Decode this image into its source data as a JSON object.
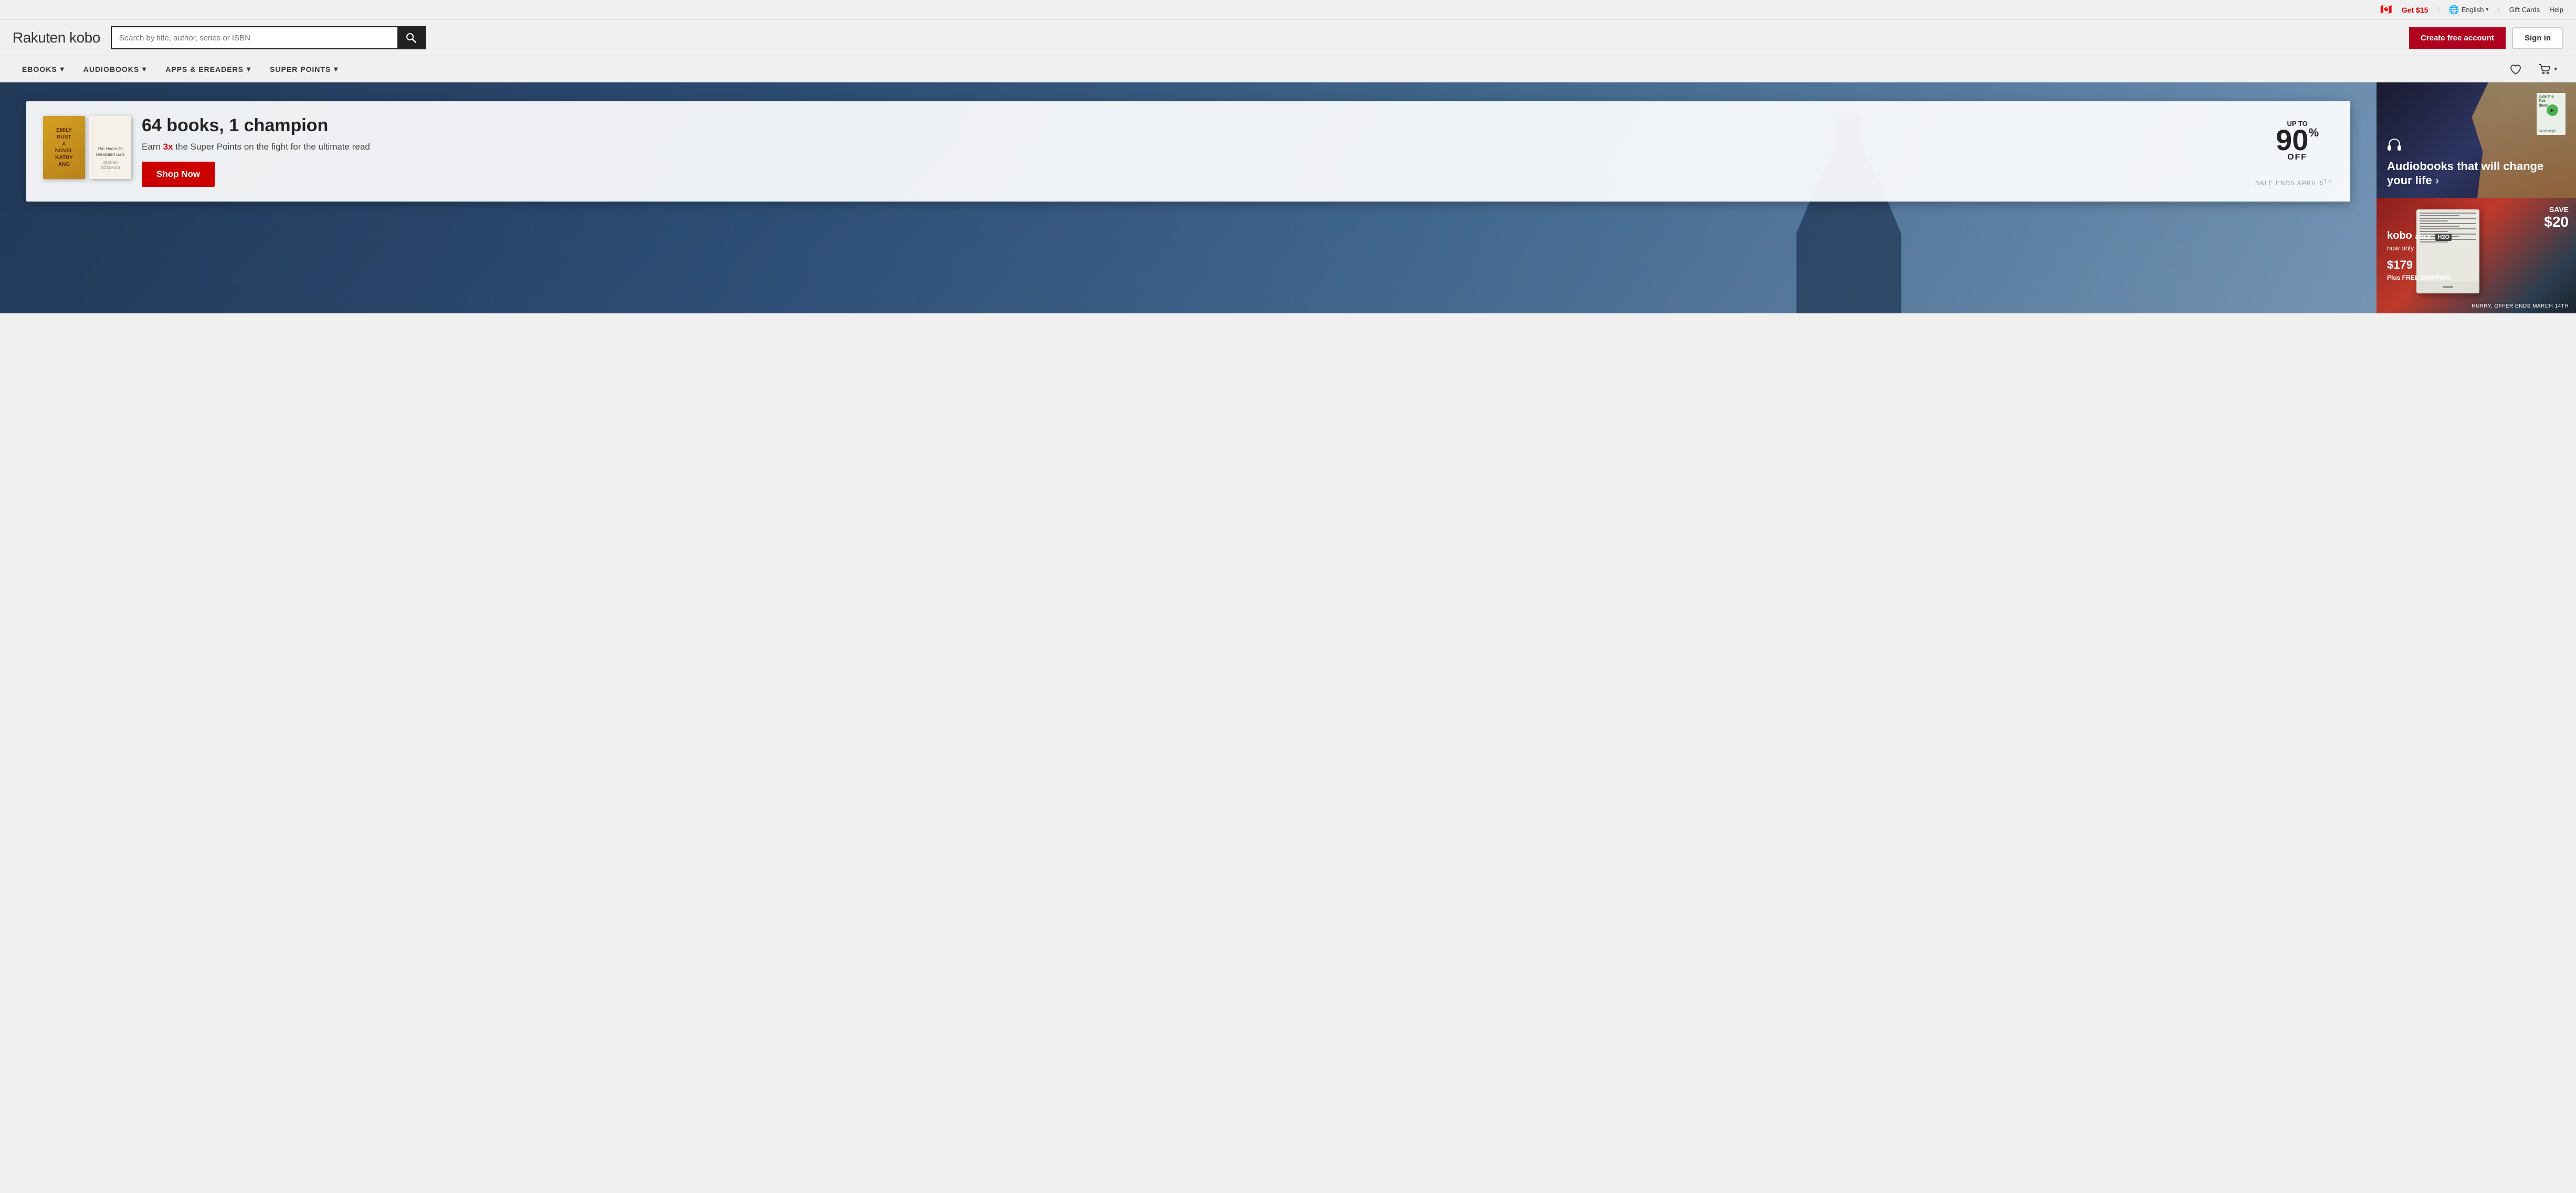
{
  "topbar": {
    "flag": "🇨🇦",
    "offer_label": "Get $15",
    "lang_label": "English",
    "gift_cards_label": "Gift Cards",
    "help_label": "Help"
  },
  "header": {
    "logo_rakuten": "Rakuten",
    "logo_kobo": " kobo",
    "search_placeholder": "Search by title, author, series or ISBN",
    "create_account_label": "Create free account",
    "sign_in_label": "Sign in"
  },
  "nav": {
    "items": [
      {
        "label": "eBOOKS"
      },
      {
        "label": "AUDIOBOOKS"
      },
      {
        "label": "APPS & eREADERS"
      },
      {
        "label": "SUPER POINTS"
      }
    ]
  },
  "hero": {
    "discount_up_to": "UP TO",
    "discount_amount": "90",
    "discount_pct": "%",
    "discount_off": "OFF",
    "promo_title": "64 books, 1 champion",
    "promo_sub_prefix": "Earn ",
    "promo_sub_bold": "3x",
    "promo_sub_suffix": " the Super Points on the fight for the ultimate read",
    "shop_now_label": "Shop Now",
    "sale_ends": "SALE ENDS APRIL 5",
    "sale_ends_sup": "TH",
    "book1_lines": [
      "EMILY",
      "RUST",
      "A",
      "NOVEL",
      "KATHY",
      "ANG"
    ],
    "book2_title": "The Home for Unwanted Girls",
    "book2_author": "JOANNA GOODMAN"
  },
  "panel_audiobooks": {
    "title": "Audiobooks that will change your life",
    "arrow": "›"
  },
  "panel_device": {
    "save_text": "SAVE",
    "save_amount": "$20",
    "brand": "kobo",
    "model": "aura",
    "model_badge": "H2O",
    "now_only": "now only",
    "price_symbol": "$",
    "price": "179",
    "free_shipping": "Plus FREE SHIPPING",
    "hurry": "HURRY, OFFER ENDS MARCH 14TH"
  },
  "colors": {
    "primary_red": "#b00020",
    "dark": "#1a1a2e",
    "device_red": "#c0392b"
  }
}
